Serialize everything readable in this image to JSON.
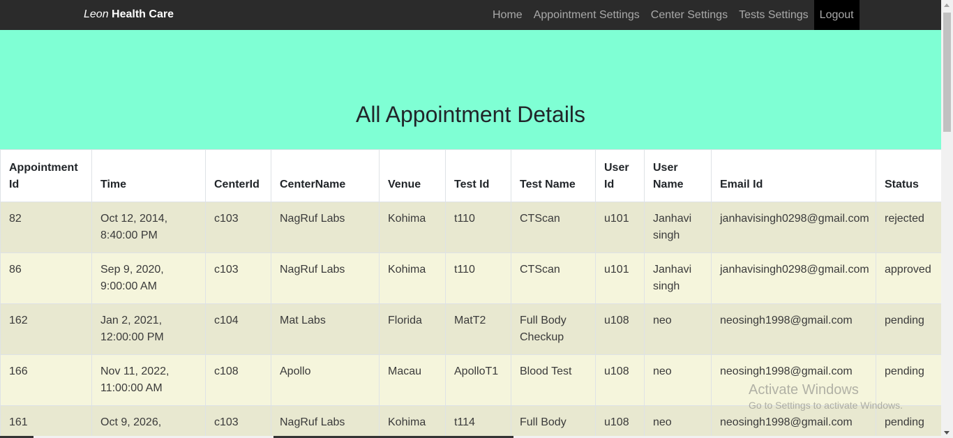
{
  "navbar": {
    "brand_part1": "Leon",
    "brand_part2": "Health Care",
    "links": [
      {
        "label": "Home"
      },
      {
        "label": "Appointment Settings"
      },
      {
        "label": "Center Settings"
      },
      {
        "label": "Tests Settings"
      },
      {
        "label": "Logout"
      }
    ]
  },
  "hero": {
    "title": "All Appointment Details"
  },
  "table": {
    "columns": [
      "Appointment Id",
      "Time",
      "CenterId",
      "CenterName",
      "Venue",
      "Test Id",
      "Test Name",
      "User Id",
      "User Name",
      "Email Id",
      "Status"
    ],
    "rows": [
      [
        "82",
        "Oct 12, 2014, 8:40:00 PM",
        "c103",
        "NagRuf Labs",
        "Kohima",
        "t110",
        "CTScan",
        "u101",
        "Janhavi singh",
        "janhavisingh0298@gmail.com",
        "rejected"
      ],
      [
        "86",
        "Sep 9, 2020, 9:00:00 AM",
        "c103",
        "NagRuf Labs",
        "Kohima",
        "t110",
        "CTScan",
        "u101",
        "Janhavi singh",
        "janhavisingh0298@gmail.com",
        "approved"
      ],
      [
        "162",
        "Jan 2, 2021, 12:00:00 PM",
        "c104",
        "Mat Labs",
        "Florida",
        "MatT2",
        "Full Body Checkup",
        "u108",
        "neo",
        "neosingh1998@gmail.com",
        "pending"
      ],
      [
        "166",
        "Nov 11, 2022, 11:00:00 AM",
        "c108",
        "Apollo",
        "Macau",
        "ApolloT1",
        "Blood Test",
        "u108",
        "neo",
        "neosingh1998@gmail.com",
        "pending"
      ],
      [
        "161",
        "Oct 9, 2026,",
        "c103",
        "NagRuf Labs",
        "Kohima",
        "t114",
        "Full Body",
        "u108",
        "neo",
        "neosingh1998@gmail.com",
        "pending"
      ]
    ]
  },
  "watermark": {
    "line1": "Activate Windows",
    "line2": "Go to Settings to activate Windows."
  }
}
